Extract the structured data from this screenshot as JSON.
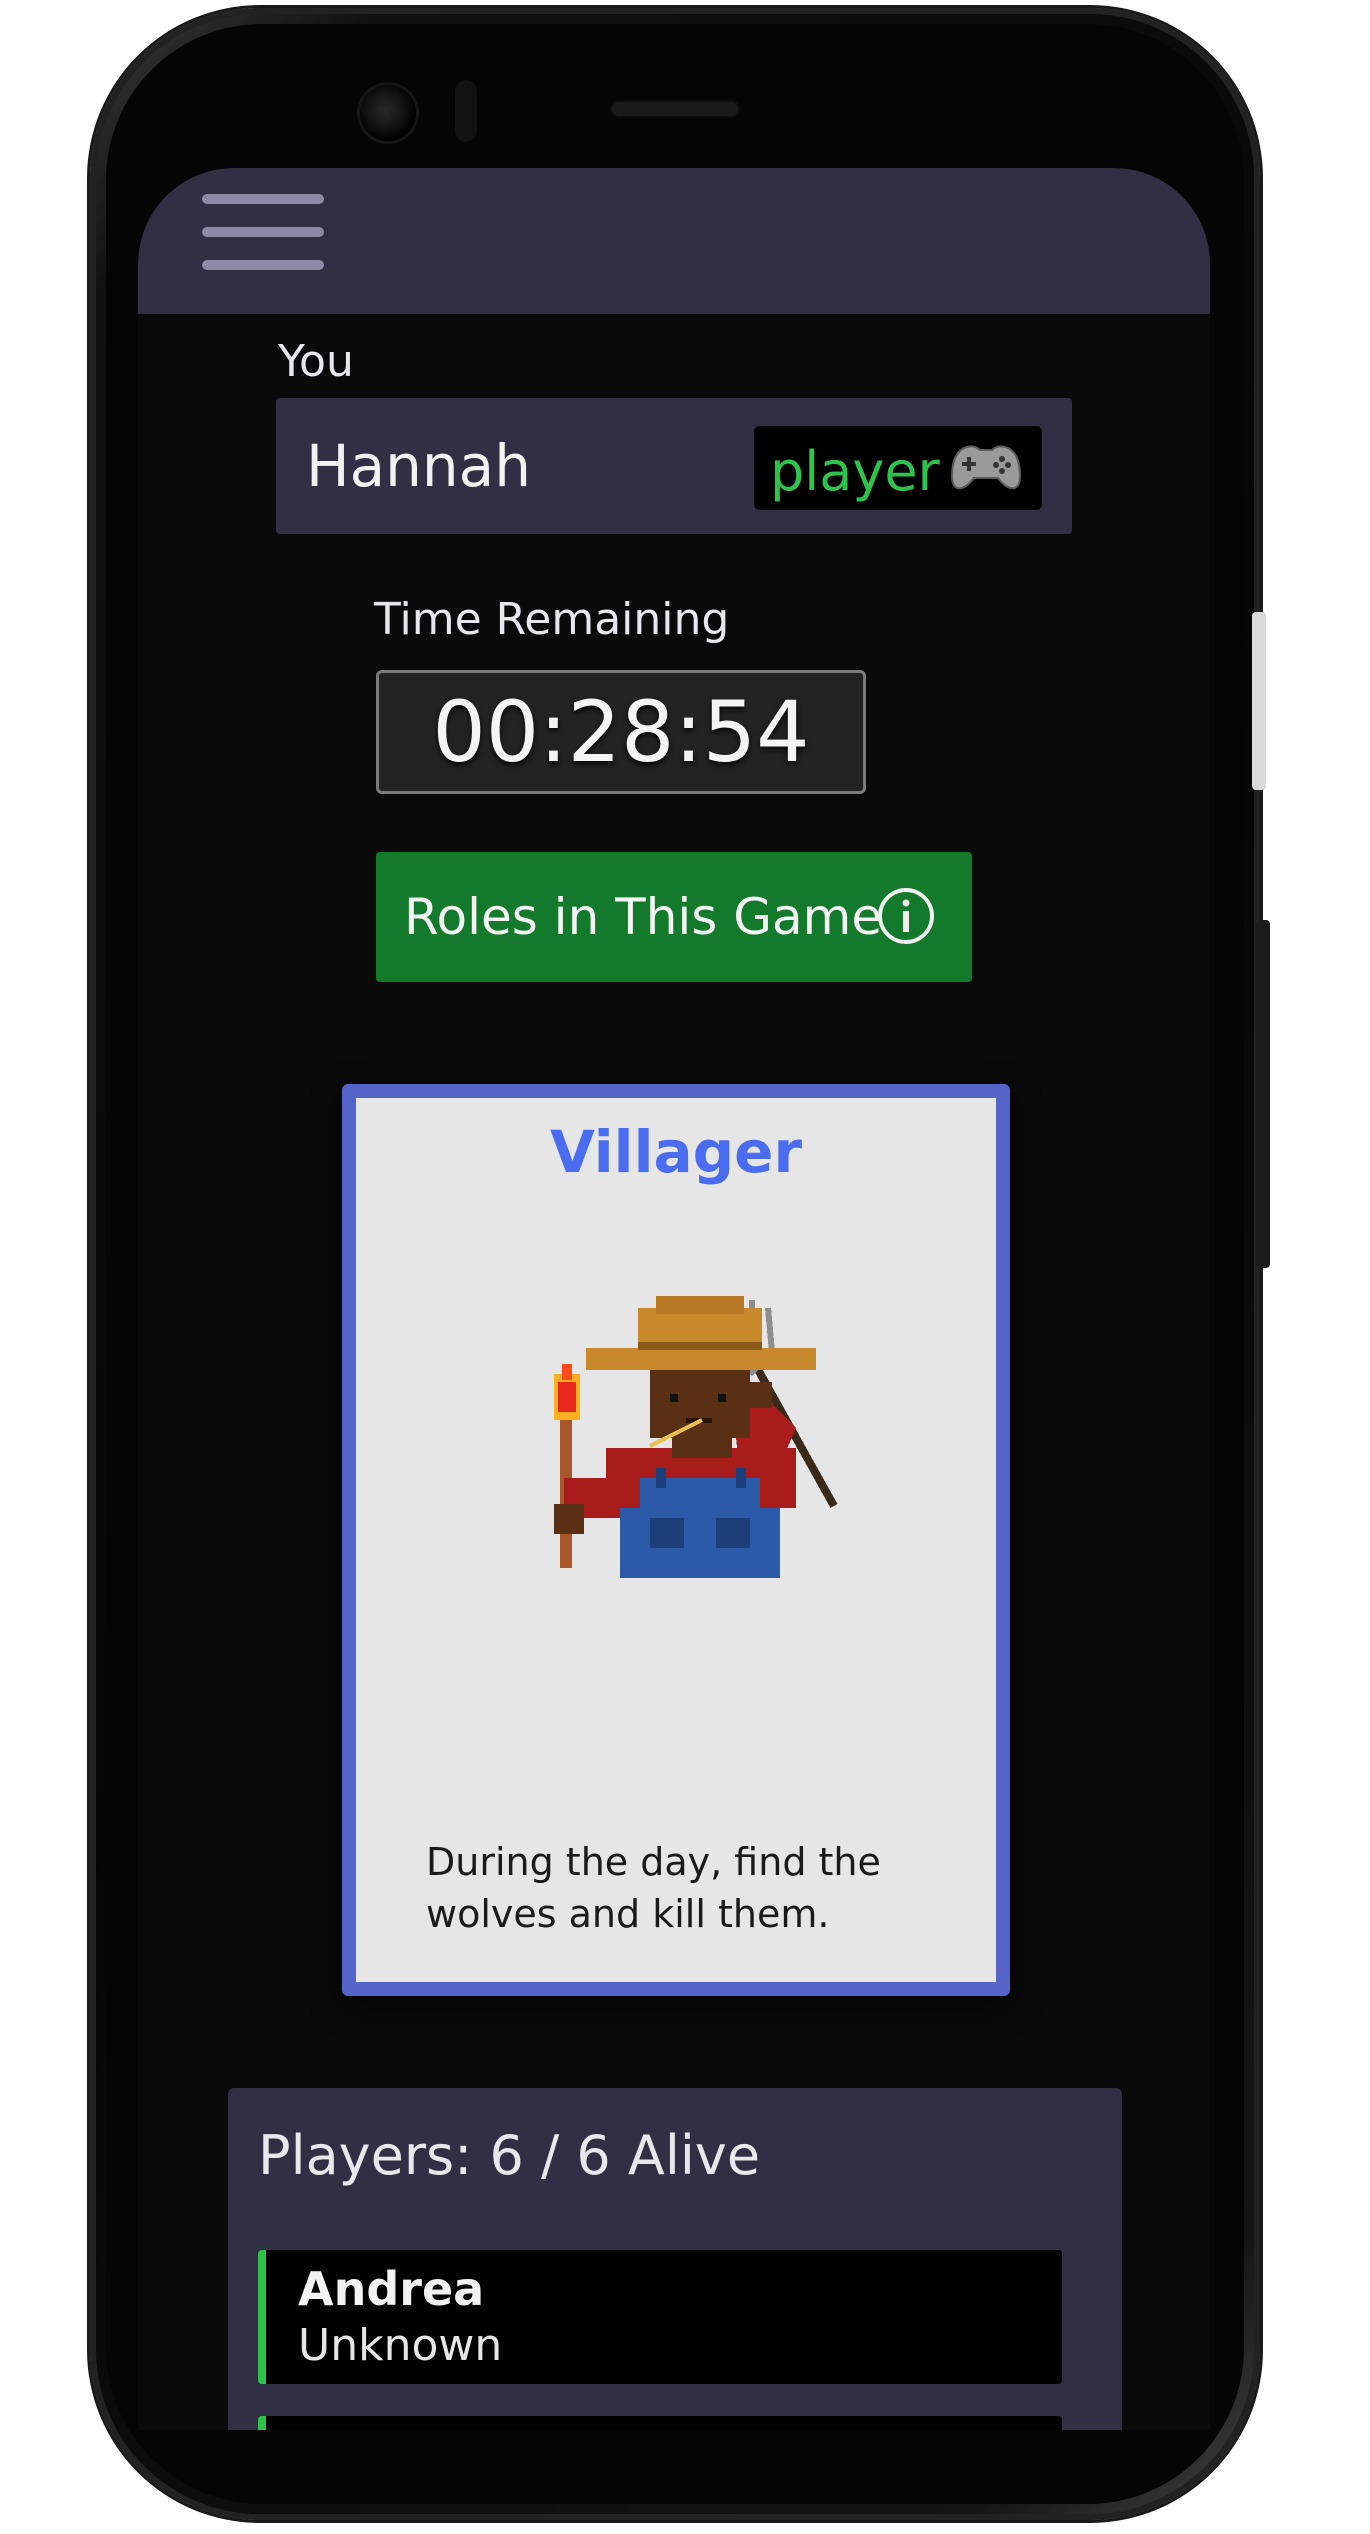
{
  "header": {
    "menu_icon": "hamburger-menu-icon"
  },
  "you": {
    "label": "You",
    "name": "Hannah",
    "badge": "player",
    "badge_icon": "gamepad-icon",
    "badge_color": "#2ec44c"
  },
  "timer": {
    "label": "Time Remaining",
    "value": "00:28:54"
  },
  "roles_button": {
    "label": "Roles in This Game",
    "icon": "info-icon",
    "color": "#127a2a"
  },
  "role_card": {
    "title": "Villager",
    "title_color": "#4a6cf0",
    "border_color": "#5564c9",
    "illustration": "villager-farmer-with-pitchfork-and-torch",
    "description": "During the day, find the wolves and kill them."
  },
  "players": {
    "title": "Players: 6 / 6 Alive",
    "alive_color": "#2ec44c",
    "items": [
      {
        "name": "Andrea",
        "role": "Unknown"
      }
    ]
  }
}
